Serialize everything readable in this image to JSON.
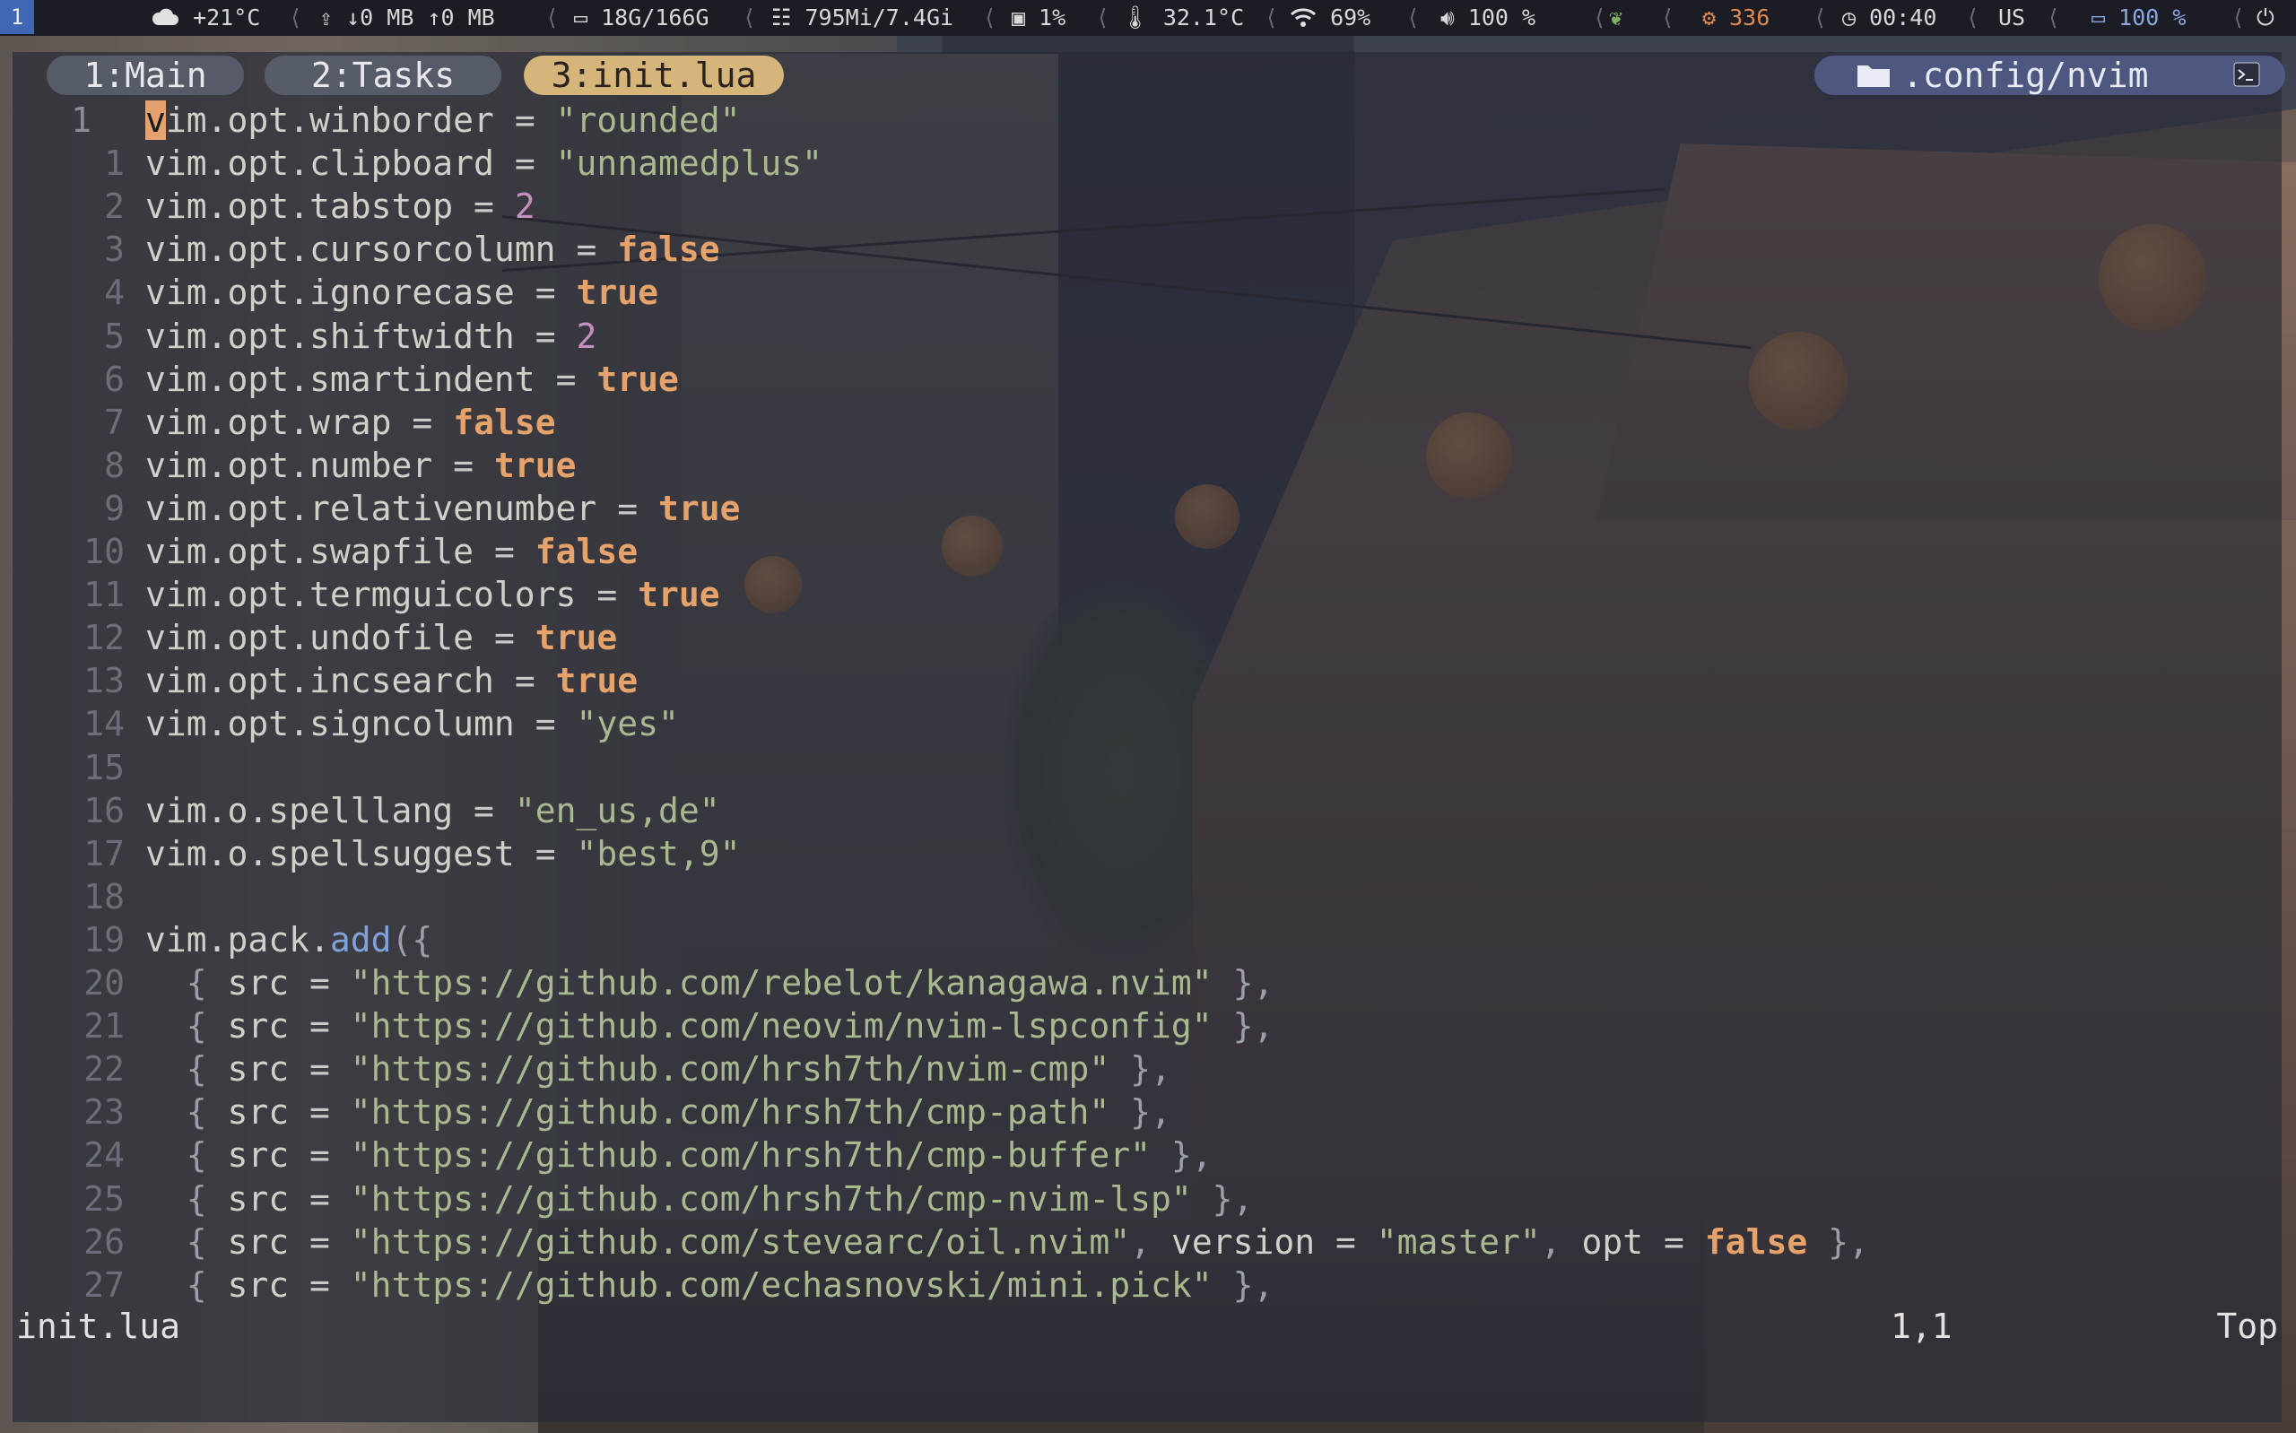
{
  "topbar": {
    "workspace": "1",
    "weather": "+21°C",
    "net_down": "↓0 MB",
    "net_up": "↑0 MB",
    "disk": "18G/166G",
    "memory": "795Mi/7.4Gi",
    "cpu": "1%",
    "temperature": "32.1°C",
    "wifi": "69%",
    "volume": "100 %",
    "updates": "336",
    "clock": "00:40",
    "keyboard": "US",
    "battery": "100 %"
  },
  "tabs": [
    "1:Main",
    "2:Tasks",
    "3:init.lua"
  ],
  "cwd": ".config/nvim",
  "colors": {
    "accent_tab": "#d6b57a",
    "cwd_pill": "#5864a0",
    "keyword": "#e5a26a",
    "string": "#a9b98f",
    "number": "#c68fc0"
  },
  "editor": {
    "lines": [
      {
        "num": "1",
        "tokens": [
          {
            "t": "v",
            "c": "cursor"
          },
          {
            "t": "im.opt.winborder ",
            "c": "id"
          },
          {
            "t": "=",
            "c": "op"
          },
          {
            "t": " \"rounded\"",
            "c": "str"
          }
        ]
      },
      {
        "num": "1",
        "tokens": [
          {
            "t": "vim.opt.clipboard ",
            "c": "id"
          },
          {
            "t": "=",
            "c": "op"
          },
          {
            "t": " \"unnamedplus\"",
            "c": "str"
          }
        ]
      },
      {
        "num": "2",
        "tokens": [
          {
            "t": "vim.opt.tabstop ",
            "c": "id"
          },
          {
            "t": "=",
            "c": "op"
          },
          {
            "t": " 2",
            "c": "num"
          }
        ]
      },
      {
        "num": "3",
        "tokens": [
          {
            "t": "vim.opt.cursorcolumn ",
            "c": "id"
          },
          {
            "t": "=",
            "c": "op"
          },
          {
            "t": " false",
            "c": "kw"
          }
        ]
      },
      {
        "num": "4",
        "tokens": [
          {
            "t": "vim.opt.ignorecase ",
            "c": "id"
          },
          {
            "t": "=",
            "c": "op"
          },
          {
            "t": " true",
            "c": "kw"
          }
        ]
      },
      {
        "num": "5",
        "tokens": [
          {
            "t": "vim.opt.shiftwidth ",
            "c": "id"
          },
          {
            "t": "=",
            "c": "op"
          },
          {
            "t": " 2",
            "c": "num"
          }
        ]
      },
      {
        "num": "6",
        "tokens": [
          {
            "t": "vim.opt.smartindent ",
            "c": "id"
          },
          {
            "t": "=",
            "c": "op"
          },
          {
            "t": " true",
            "c": "kw"
          }
        ]
      },
      {
        "num": "7",
        "tokens": [
          {
            "t": "vim.opt.wrap ",
            "c": "id"
          },
          {
            "t": "=",
            "c": "op"
          },
          {
            "t": " false",
            "c": "kw"
          }
        ]
      },
      {
        "num": "8",
        "tokens": [
          {
            "t": "vim.opt.number ",
            "c": "id"
          },
          {
            "t": "=",
            "c": "op"
          },
          {
            "t": " true",
            "c": "kw"
          }
        ]
      },
      {
        "num": "9",
        "tokens": [
          {
            "t": "vim.opt.relativenumber ",
            "c": "id"
          },
          {
            "t": "=",
            "c": "op"
          },
          {
            "t": " true",
            "c": "kw"
          }
        ]
      },
      {
        "num": "10",
        "tokens": [
          {
            "t": "vim.opt.swapfile ",
            "c": "id"
          },
          {
            "t": "=",
            "c": "op"
          },
          {
            "t": " false",
            "c": "kw"
          }
        ]
      },
      {
        "num": "11",
        "tokens": [
          {
            "t": "vim.opt.termguicolors ",
            "c": "id"
          },
          {
            "t": "=",
            "c": "op"
          },
          {
            "t": " true",
            "c": "kw"
          }
        ]
      },
      {
        "num": "12",
        "tokens": [
          {
            "t": "vim.opt.undofile ",
            "c": "id"
          },
          {
            "t": "=",
            "c": "op"
          },
          {
            "t": " true",
            "c": "kw"
          }
        ]
      },
      {
        "num": "13",
        "tokens": [
          {
            "t": "vim.opt.incsearch ",
            "c": "id"
          },
          {
            "t": "=",
            "c": "op"
          },
          {
            "t": " true",
            "c": "kw"
          }
        ]
      },
      {
        "num": "14",
        "tokens": [
          {
            "t": "vim.opt.signcolumn ",
            "c": "id"
          },
          {
            "t": "=",
            "c": "op"
          },
          {
            "t": " \"yes\"",
            "c": "str"
          }
        ]
      },
      {
        "num": "15",
        "tokens": []
      },
      {
        "num": "16",
        "tokens": [
          {
            "t": "vim.o.spelllang ",
            "c": "id"
          },
          {
            "t": "=",
            "c": "op"
          },
          {
            "t": " \"en_us,de\"",
            "c": "str"
          }
        ]
      },
      {
        "num": "17",
        "tokens": [
          {
            "t": "vim.o.spellsuggest ",
            "c": "id"
          },
          {
            "t": "=",
            "c": "op"
          },
          {
            "t": " \"best,9\"",
            "c": "str"
          }
        ]
      },
      {
        "num": "18",
        "tokens": []
      },
      {
        "num": "19",
        "tokens": [
          {
            "t": "vim.pack.",
            "c": "id"
          },
          {
            "t": "add",
            "c": "fn"
          },
          {
            "t": "({",
            "c": "punc"
          }
        ]
      },
      {
        "num": "20",
        "tokens": [
          {
            "t": "  { ",
            "c": "punc"
          },
          {
            "t": "src ",
            "c": "id"
          },
          {
            "t": "=",
            "c": "op"
          },
          {
            "t": " \"https://github.com/rebelot/kanagawa.nvim\"",
            "c": "str"
          },
          {
            "t": " },",
            "c": "punc"
          }
        ]
      },
      {
        "num": "21",
        "tokens": [
          {
            "t": "  { ",
            "c": "punc"
          },
          {
            "t": "src ",
            "c": "id"
          },
          {
            "t": "=",
            "c": "op"
          },
          {
            "t": " \"https://github.com/neovim/nvim-lspconfig\"",
            "c": "str"
          },
          {
            "t": " },",
            "c": "punc"
          }
        ]
      },
      {
        "num": "22",
        "tokens": [
          {
            "t": "  { ",
            "c": "punc"
          },
          {
            "t": "src ",
            "c": "id"
          },
          {
            "t": "=",
            "c": "op"
          },
          {
            "t": " \"https://github.com/hrsh7th/nvim-cmp\"",
            "c": "str"
          },
          {
            "t": " },",
            "c": "punc"
          }
        ]
      },
      {
        "num": "23",
        "tokens": [
          {
            "t": "  { ",
            "c": "punc"
          },
          {
            "t": "src ",
            "c": "id"
          },
          {
            "t": "=",
            "c": "op"
          },
          {
            "t": " \"https://github.com/hrsh7th/cmp-path\"",
            "c": "str"
          },
          {
            "t": " },",
            "c": "punc"
          }
        ]
      },
      {
        "num": "24",
        "tokens": [
          {
            "t": "  { ",
            "c": "punc"
          },
          {
            "t": "src ",
            "c": "id"
          },
          {
            "t": "=",
            "c": "op"
          },
          {
            "t": " \"https://github.com/hrsh7th/cmp-buffer\"",
            "c": "str"
          },
          {
            "t": " },",
            "c": "punc"
          }
        ]
      },
      {
        "num": "25",
        "tokens": [
          {
            "t": "  { ",
            "c": "punc"
          },
          {
            "t": "src ",
            "c": "id"
          },
          {
            "t": "=",
            "c": "op"
          },
          {
            "t": " \"https://github.com/hrsh7th/cmp-nvim-lsp\"",
            "c": "str"
          },
          {
            "t": " },",
            "c": "punc"
          }
        ]
      },
      {
        "num": "26",
        "tokens": [
          {
            "t": "  { ",
            "c": "punc"
          },
          {
            "t": "src ",
            "c": "id"
          },
          {
            "t": "=",
            "c": "op"
          },
          {
            "t": " \"https://github.com/stevearc/oil.nvim\"",
            "c": "str"
          },
          {
            "t": ", ",
            "c": "punc"
          },
          {
            "t": "version ",
            "c": "id"
          },
          {
            "t": "=",
            "c": "op"
          },
          {
            "t": " \"master\"",
            "c": "str"
          },
          {
            "t": ", ",
            "c": "punc"
          },
          {
            "t": "opt ",
            "c": "id"
          },
          {
            "t": "=",
            "c": "op"
          },
          {
            "t": " false",
            "c": "kw"
          },
          {
            "t": " },",
            "c": "punc"
          }
        ]
      },
      {
        "num": "27",
        "tokens": [
          {
            "t": "  { ",
            "c": "punc"
          },
          {
            "t": "src ",
            "c": "id"
          },
          {
            "t": "=",
            "c": "op"
          },
          {
            "t": " \"https://github.com/echasnovski/mini.pick\"",
            "c": "str"
          },
          {
            "t": " },",
            "c": "punc"
          }
        ]
      }
    ]
  },
  "statusline": {
    "file": "init.lua",
    "position": "1,1",
    "scroll": "Top"
  }
}
